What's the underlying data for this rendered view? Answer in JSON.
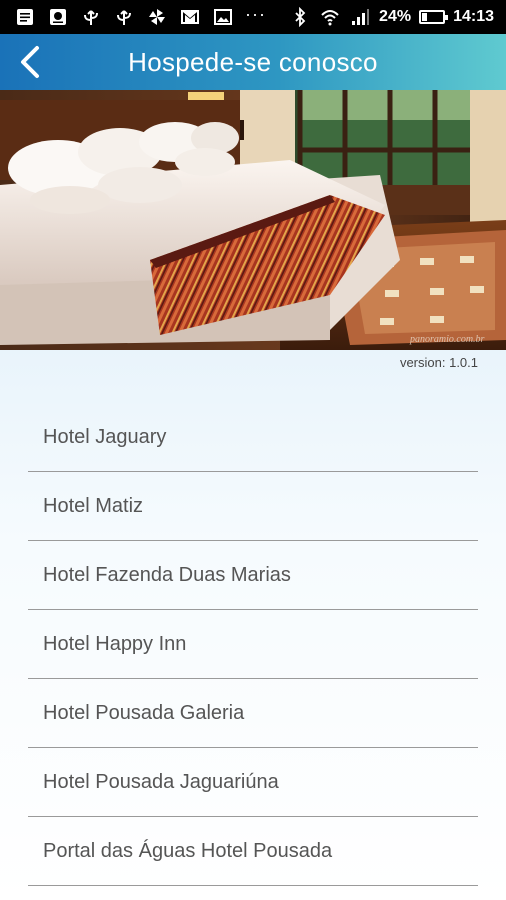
{
  "status_bar": {
    "battery_text": "24%",
    "battery_level": 0.24,
    "time": "14:13",
    "overflow_text": "···",
    "icons": [
      "notes-icon",
      "recorder-icon",
      "usb-icon",
      "usb-icon",
      "pinwheel-icon",
      "gmail-icon",
      "gallery-icon",
      "bluetooth-icon",
      "wifi-icon",
      "signal-icon",
      "battery-icon"
    ]
  },
  "header": {
    "title": "Hospede-se conosco",
    "back_icon": "chevron-left-icon",
    "colors": {
      "start": "#1a72b8",
      "end": "#5fcad0"
    }
  },
  "hero": {
    "image": "hotel-room-photo",
    "watermark": "panoramio.com.br"
  },
  "version": {
    "label": "version: 1.0.1"
  },
  "hotels": [
    "Hotel Jaguary",
    "Hotel Matiz",
    "Hotel Fazenda Duas Marias",
    "Hotel Happy Inn",
    "Hotel Pousada Galeria",
    "Hotel Pousada Jaguariúna",
    "Portal das Águas Hotel Pousada"
  ]
}
